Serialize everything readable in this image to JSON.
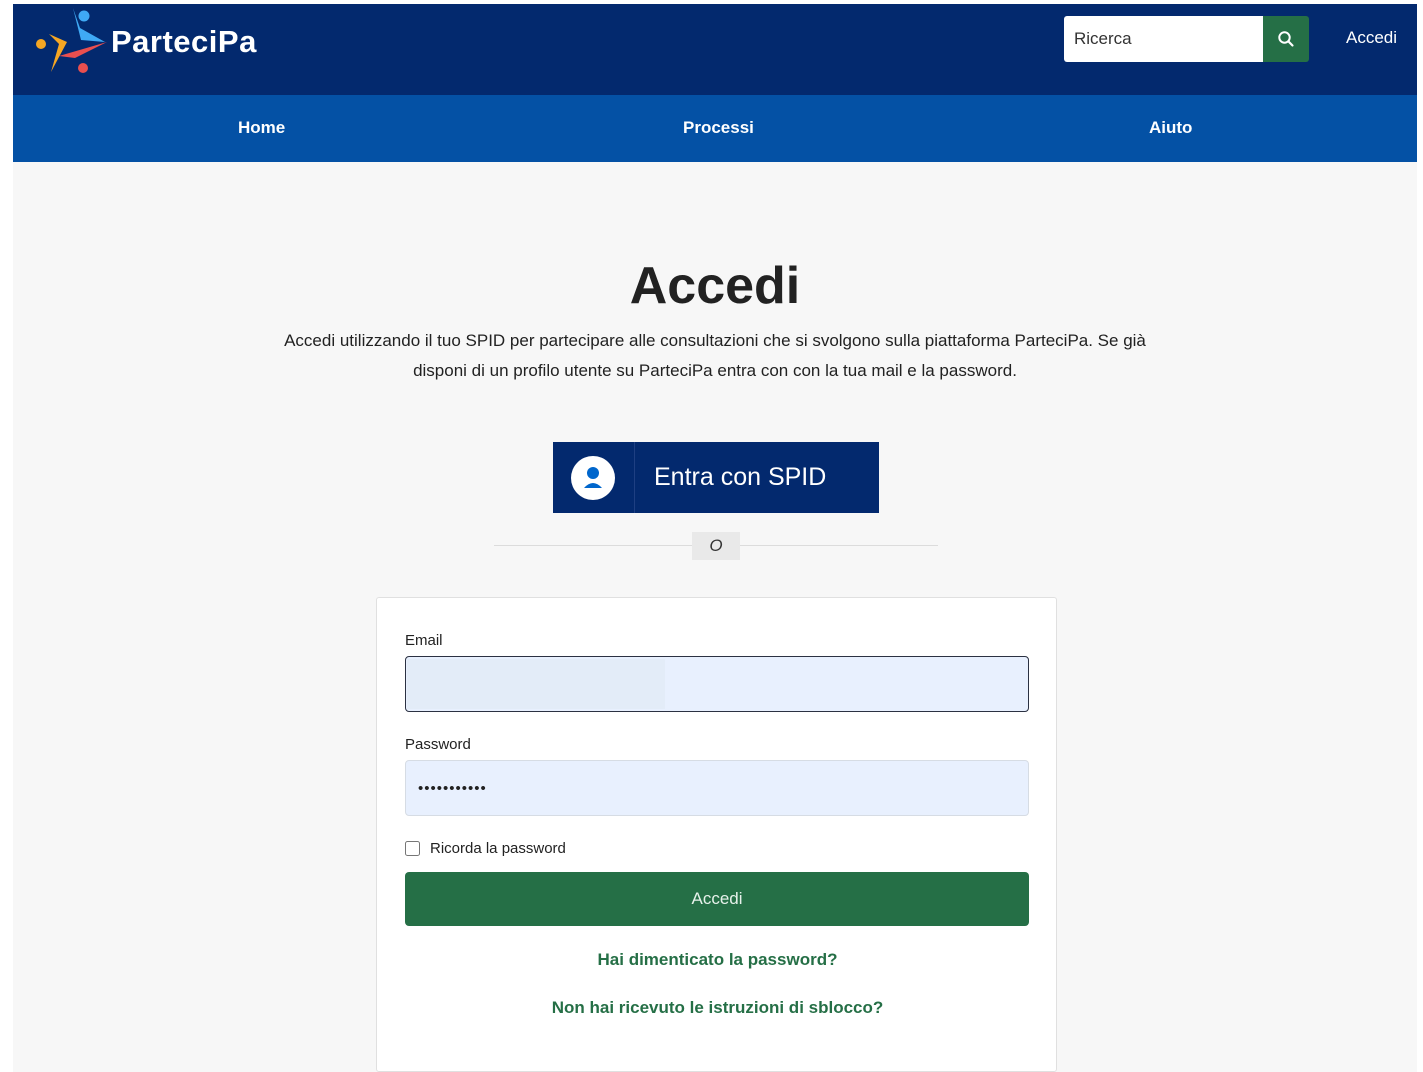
{
  "header": {
    "logo_text": "ParteciPa",
    "search_placeholder": "Ricerca",
    "login_link": "Accedi"
  },
  "nav": {
    "items": [
      {
        "label": "Home"
      },
      {
        "label": "Processi"
      },
      {
        "label": "Aiuto"
      }
    ]
  },
  "main": {
    "title": "Accedi",
    "intro_line1": "Accedi utilizzando il tuo SPID per partecipare alle consultazioni che si svolgono sulla piattaforma ParteciPa. Se già",
    "intro_line2": "disponi di un profilo utente su ParteciPa entra con con la tua mail e la password.",
    "spid_button": "Entra con SPID",
    "or_separator": "O"
  },
  "form": {
    "email_label": "Email",
    "email_value": "",
    "password_label": "Password",
    "password_value": "•••••••••••",
    "remember_label": "Ricorda la password",
    "remember_checked": false,
    "submit_label": "Accedi",
    "forgot_password_link": "Hai dimenticato la password?",
    "unlock_link": "Non hai ricevuto le istruzioni di sblocco?"
  },
  "colors": {
    "header_bg": "#03296e",
    "nav_bg": "#0451a5",
    "accent_green": "#256f46",
    "page_bg": "#f7f7f7"
  },
  "icons": {
    "search": "search-icon",
    "spid": "user-icon",
    "logo": "participation-logo-icon"
  }
}
